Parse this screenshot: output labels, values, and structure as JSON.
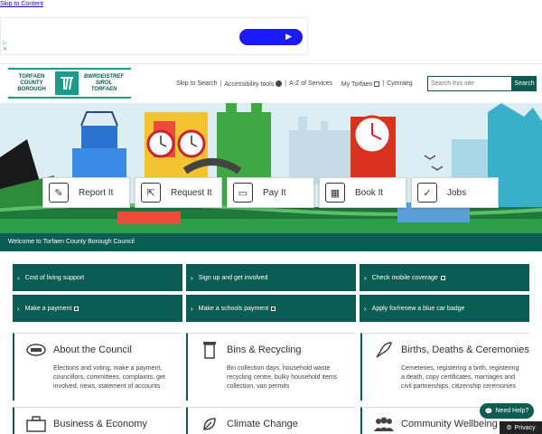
{
  "skip_link": "Skip to Content",
  "ad": {
    "icons": "▷\n✕"
  },
  "logo": {
    "english": [
      "TORFAEN",
      "COUNTY",
      "BOROUGH"
    ],
    "welsh": [
      "BWRDEISTREF",
      "SIROL",
      "TORFAEN"
    ]
  },
  "topnav": {
    "skip_search": "Skip to Search",
    "accessibility": "Accessibility tools",
    "az": "A-Z of Services",
    "my_torfaen": "My Torfaen",
    "cymraeg": "Cymraeg"
  },
  "search": {
    "placeholder": "Search this site",
    "button": "Search"
  },
  "quick_links": [
    {
      "label": "Report It",
      "icon": "pencil-icon"
    },
    {
      "label": "Request It",
      "icon": "cursor-click-icon"
    },
    {
      "label": "Pay It",
      "icon": "credit-card-icon"
    },
    {
      "label": "Book It",
      "icon": "calendar-icon"
    },
    {
      "label": "Jobs",
      "icon": "checkbox-icon"
    }
  ],
  "welcome": "Welcome to Torfaen County Borough Council",
  "buttons": [
    {
      "label": "Cost of living support",
      "external": false
    },
    {
      "label": "Sign up and get involved",
      "external": false
    },
    {
      "label": "Check mobile coverage",
      "external": true
    },
    {
      "label": "Make a payment",
      "external": true
    },
    {
      "label": "Make a schools payment",
      "external": true
    },
    {
      "label": "Apply for/renew a blue car badge",
      "external": false
    }
  ],
  "cards": [
    {
      "title": "About the Council",
      "icon": "council-icon",
      "desc": "Elections and voting, make a payment, councillors, committees, complaints, get involved, news, statement of accounts"
    },
    {
      "title": "Bins & Recycling",
      "icon": "bin-icon",
      "desc": "Bin collection days, household waste recycling centre, bulky household items collection, van permits"
    },
    {
      "title": "Births, Deaths & Ceremonies",
      "icon": "quill-icon",
      "desc": "Cemeteries, registering a birth, registering a death, copy certificates, marriages and civil partnerships, citizenship ceremonies"
    },
    {
      "title": "Business & Economy",
      "icon": "briefcase-icon",
      "desc": ""
    },
    {
      "title": "Climate Change",
      "icon": "leaf-icon",
      "desc": ""
    },
    {
      "title": "Community Wellbeing",
      "icon": "people-icon",
      "desc": ""
    }
  ],
  "need_help": "Need Help?",
  "privacy": "Privacy",
  "colors": {
    "primary": "#0b5c52",
    "accent": "#1a9b8b",
    "ad_button": "#1a1aff"
  }
}
